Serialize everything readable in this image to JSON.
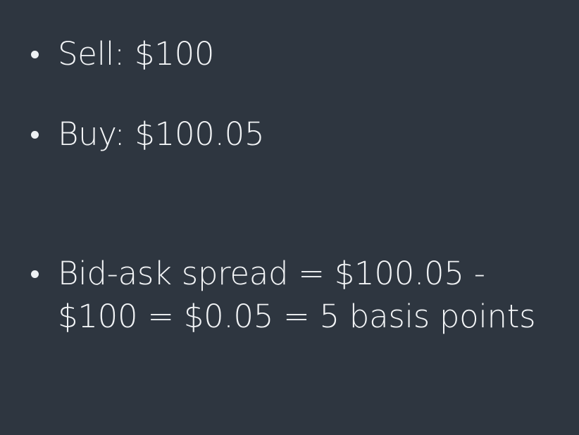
{
  "slide": {
    "background": "#2e3640",
    "text_color": "#f2f4f6",
    "bullets": [
      {
        "text": "Sell: $100"
      },
      {
        "text": "Buy: $100.05"
      },
      {
        "text": "Bid-ask spread = $100.05 - $100 = $0.05 = 5 basis points"
      }
    ]
  }
}
